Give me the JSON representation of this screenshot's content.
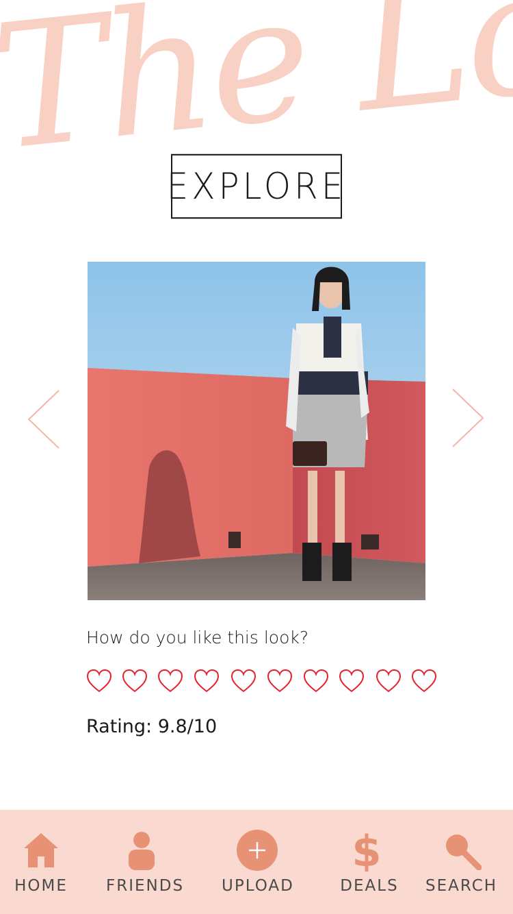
{
  "brand": {
    "title": "The Look"
  },
  "header": {
    "explore_label": "EXPLORE"
  },
  "carousel": {
    "prev_icon": "chevron-left-icon",
    "next_icon": "chevron-right-icon"
  },
  "rating": {
    "question": "How do you like this look?",
    "hearts_total": 10,
    "hearts_selected": 0,
    "text": "Rating: 9.8/10"
  },
  "tabbar": {
    "tabs": [
      {
        "label": "HOME",
        "icon": "home-icon"
      },
      {
        "label": "FRIENDS",
        "icon": "user-icon"
      },
      {
        "label": "UPLOAD",
        "icon": "plus-circle-icon"
      },
      {
        "label": "DEALS",
        "icon": "dollar-icon"
      },
      {
        "label": "SEARCH",
        "icon": "search-icon"
      }
    ]
  },
  "colors": {
    "accent": "#e79274",
    "brand_pink": "#f8d0c4",
    "tabbar_bg": "#fadad0",
    "heart": "#e8202a"
  }
}
